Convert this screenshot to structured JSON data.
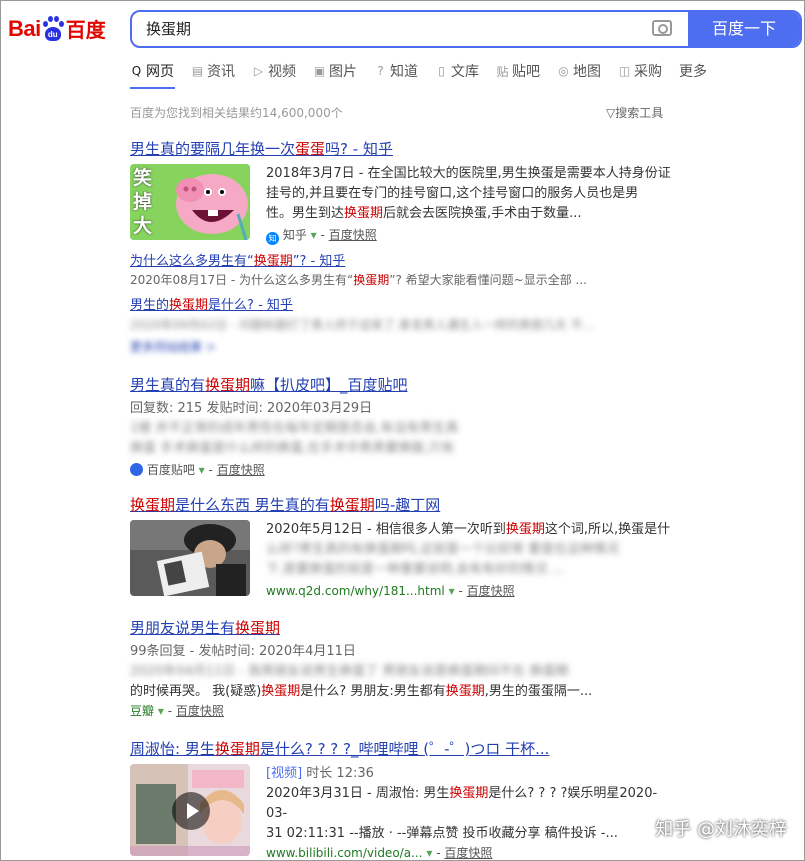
{
  "logo": {
    "bai": "Bai",
    "du": "du",
    "cn": "百度"
  },
  "search": {
    "query": "换蛋期",
    "button": "百度一下"
  },
  "tabs": [
    {
      "icon": "Q",
      "label": "网页"
    },
    {
      "icon": "▤",
      "label": "资讯"
    },
    {
      "icon": "▷",
      "label": "视频"
    },
    {
      "icon": "▣",
      "label": "图片"
    },
    {
      "icon": "?",
      "label": "知道"
    },
    {
      "icon": "▯",
      "label": "文库"
    },
    {
      "icon": "贴",
      "label": "贴吧"
    },
    {
      "icon": "◎",
      "label": "地图"
    },
    {
      "icon": "◫",
      "label": "采购"
    },
    {
      "icon": "",
      "label": "更多"
    }
  ],
  "result_count": "百度为您找到相关结果约14,600,000个",
  "search_tools": "▽搜索工具",
  "r1": {
    "title_a": "男生真的要隔几年换一次",
    "title_em": "蛋蛋",
    "title_b": "吗? - 知乎",
    "thumb_text": "笑掉大",
    "l1": "2018年3月7日 - 在全国比较大的医院里,男生换蛋是需要本人持身份证",
    "l2": "挂号的,并且要在专门的挂号窗口,这个挂号窗口的服务人员也是男",
    "l3a": "性。男生到达",
    "l3em": "换蛋期",
    "l3b": "后就会去医院换蛋,手术由于数量...",
    "src": "知乎",
    "arrow": "▾",
    "sep": "-",
    "kz": "百度快照"
  },
  "r1sub1": {
    "title_a": "为什么这么多男生有“",
    "title_em": "换蛋期",
    "title_b": "”? - 知乎",
    "line_a": "2020年08月17日 - 为什么这么多男生有“",
    "line_em": "换蛋期",
    "line_b": "”? 希望大家能看懂问题~显示全部 ..."
  },
  "r1sub2": {
    "title_a": "男生的",
    "title_em": "换蛋期",
    "title_b": "是什么? - 知乎",
    "blur": "2020年09月02日 - 问题标题打了男人终于迎来了,拿发男人遇生人一样的男朋几天 不...",
    "more": "更多同站结果 >"
  },
  "r2": {
    "title_a": "男生真的有",
    "title_em": "换蛋期",
    "title_b": "嘛【扒皮吧】_百度贴吧",
    "meta": "回复数: 215 发贴时间: 2020年03月29日",
    "b1": "1楼 并不正常的成年男性在每年定期是否会,有没有男生真",
    "b2": "换蛋 手术换蛋是什么样的换蛋,在手术中男男要换服,只有",
    "src": "百度贴吧",
    "arrow": "▾",
    "sep": "-",
    "kz": "百度快照"
  },
  "r3": {
    "title_em1": "换蛋期",
    "title_a": "是什么东西 男生真的有",
    "title_em2": "换蛋期",
    "title_b": "吗-趣丁网",
    "l1a": "2020年5月12日 - 相信很多人第一次听到",
    "l1em": "换蛋期",
    "l1b": "这个词,所以,换蛋是什",
    "b1": "么样?男生真的有换蛋期吗,这就是一个比较常 要是在这种情况",
    "b2": "下,是要换蛋的就是一种重要说明,会有有好的情况 ...",
    "url": "www.q2d.com/why/181...html",
    "arrow": "▾",
    "sep": "-",
    "kz": "百度快照"
  },
  "r4": {
    "title_a": "男朋友说男生有",
    "title_em": "换蛋期",
    "meta": "99条回复 - 发帖时间: 2020年4月11日",
    "b1": "2020年04月11日 - 我男朋友说男生换蛋了 男朋友说是换蛋期间不在 换蛋期",
    "l2a": "的时候再哭。 我(疑惑)",
    "l2em": "换蛋期",
    "l2b": "是什么? 男朋友:男生都有",
    "l2em2": "换蛋期",
    "l2c": ",男生的蛋蛋隔一...",
    "src": "豆瓣",
    "arrow": "▾",
    "sep": "-",
    "kz": "百度快照"
  },
  "r5": {
    "title_a": "周淑怡: 男生",
    "title_em": "换蛋期",
    "title_b": "是什么? ? ? ?_哔哩哔哩 (゜-゜)つロ 干杯...",
    "tag": "[视频]",
    "dur": "时长 12:36",
    "l1a": "2020年3月31日 - 周淑怡: 男生",
    "l1em": "换蛋期",
    "l1b": "是什么? ? ? ?娱乐明星2020-03-",
    "l2": "31 02:11:31 --播放 · --弹幕点赞 投币收藏分享 稿件投诉 -...",
    "url": "www.bilibili.com/video/a...",
    "arrow": "▾",
    "sep": "-",
    "kz": "百度快照"
  },
  "watermark": "知乎 @刘沐奕梓"
}
